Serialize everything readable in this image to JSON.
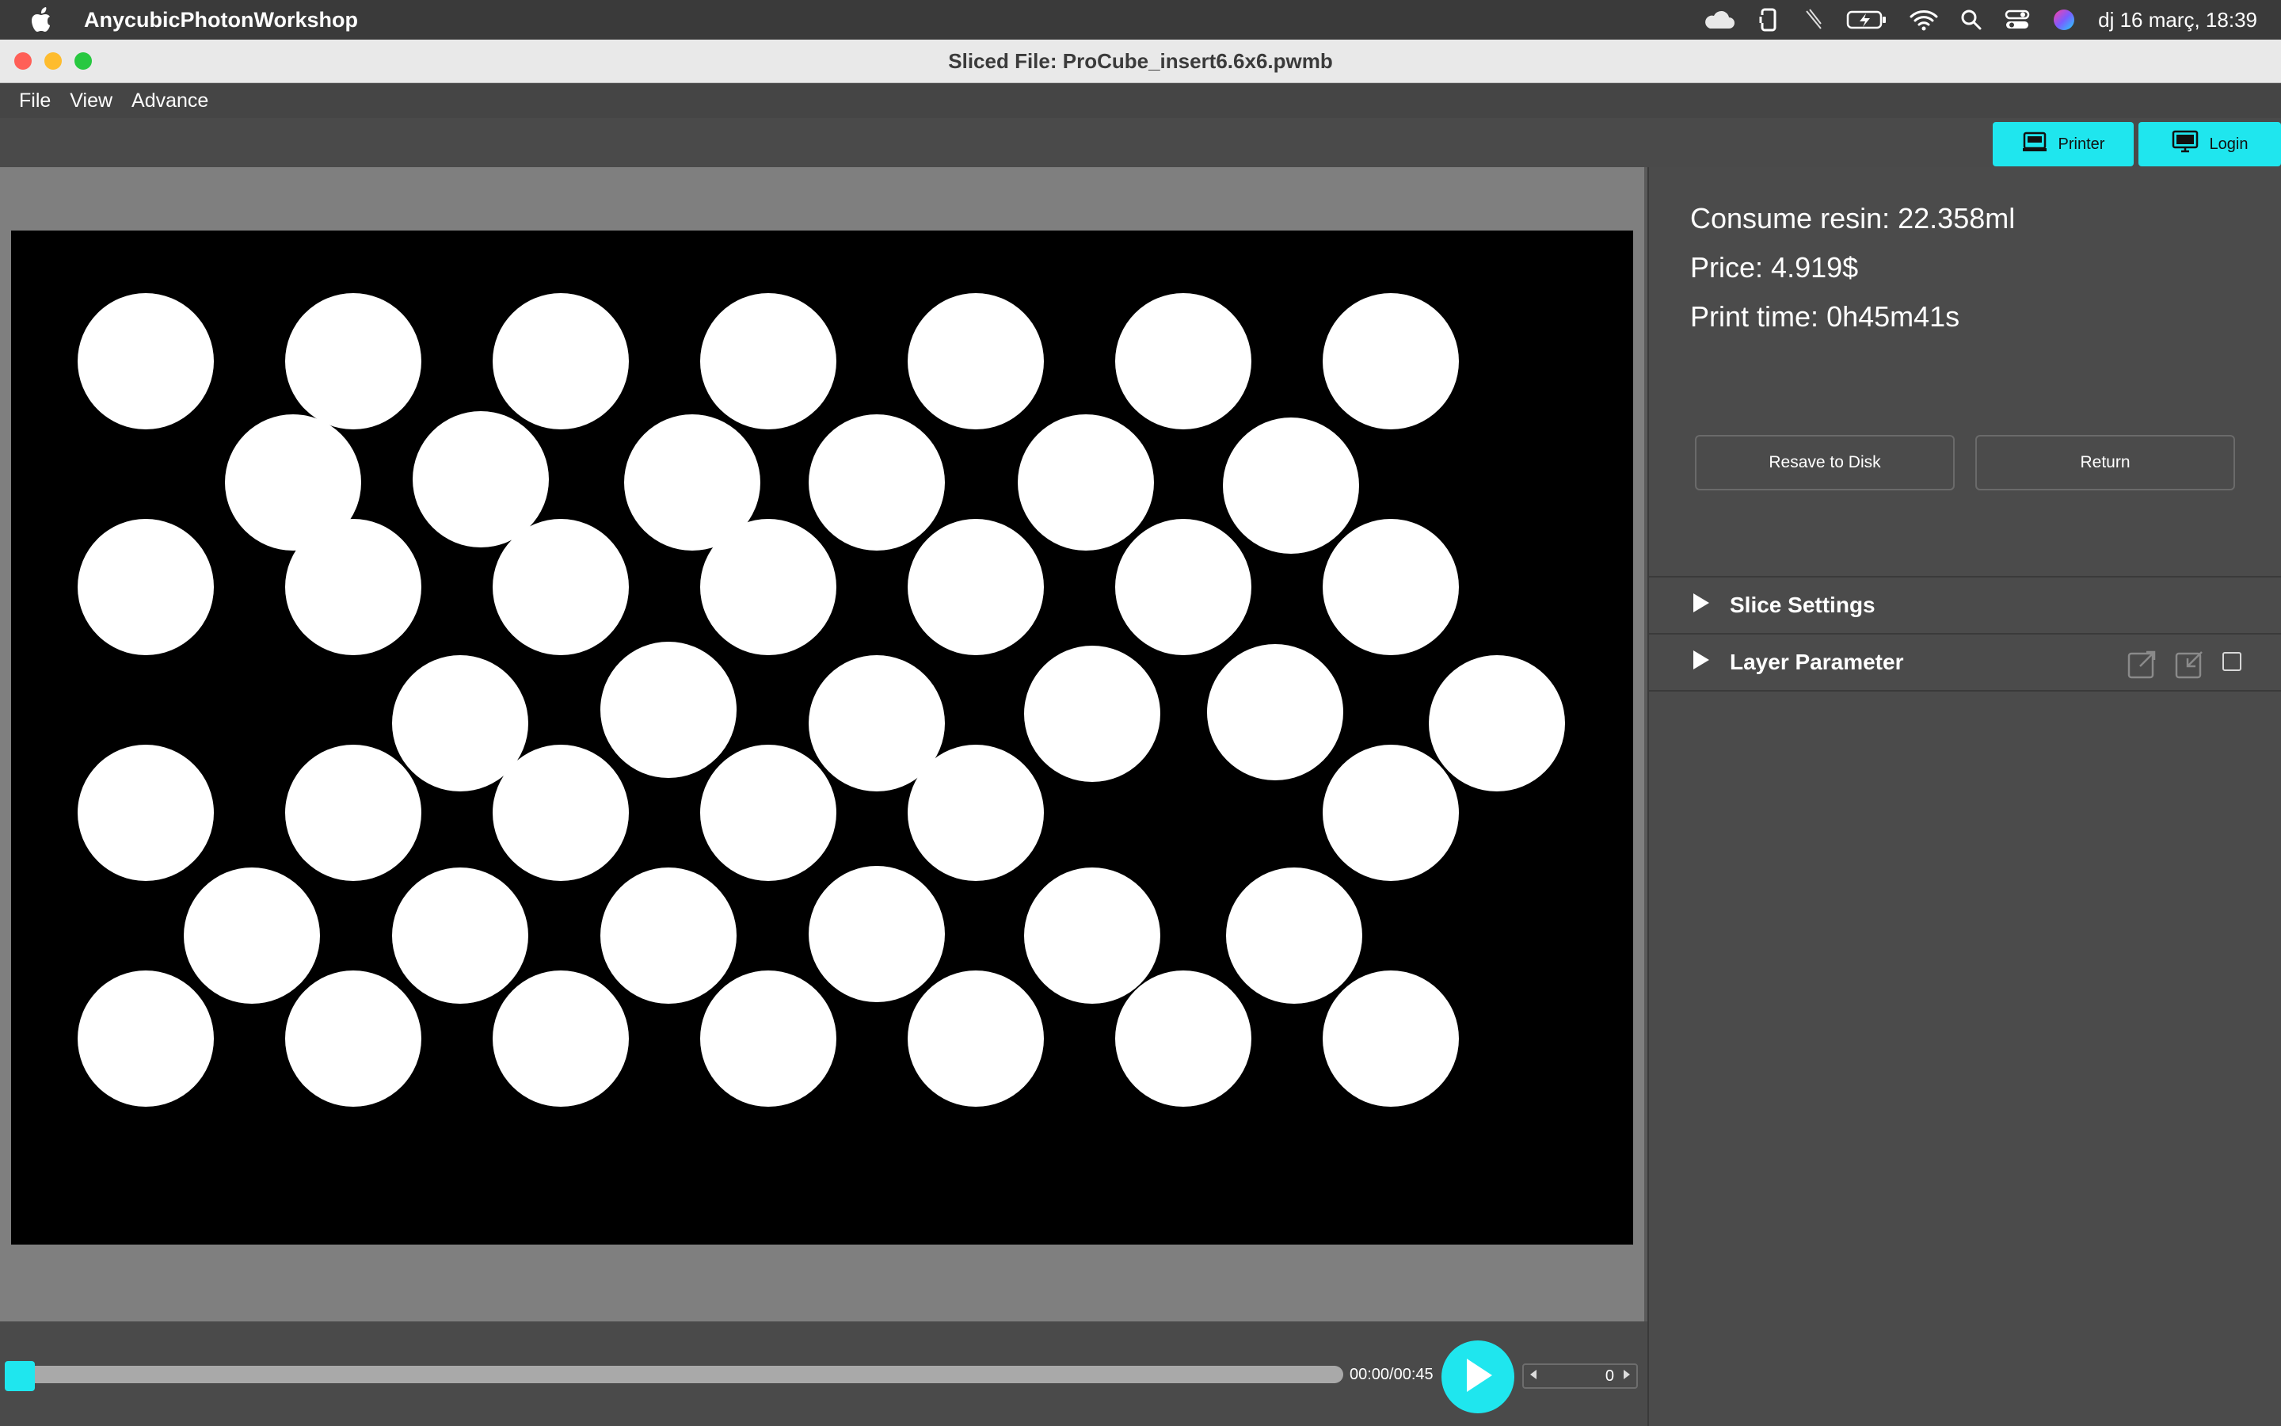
{
  "menubar": {
    "app_name": "AnycubicPhotonWorkshop",
    "clock": "dj 16 març, 18:39",
    "icons": [
      "apple-icon",
      "cloud-icon",
      "phone-sync-icon",
      "pen-icon",
      "battery-icon",
      "wifi-icon",
      "search-icon",
      "control-center-icon",
      "siri-icon"
    ]
  },
  "window": {
    "title": "Sliced File: ProCube_insert6.6x6.pwmb",
    "traffic_light_colors": [
      "#ff5f57",
      "#febc2e",
      "#28c840"
    ]
  },
  "app_menu": [
    "File",
    "View",
    "Advance"
  ],
  "toolbar": {
    "printer_label": "Printer",
    "login_label": "Login",
    "accent": "#1fe6ee"
  },
  "playback": {
    "timecode": "00:00/00:45",
    "layer_value": "0",
    "progress": 0
  },
  "info": {
    "resin_label": "Consume resin:",
    "resin_value": "22.358ml",
    "price_label": "Price:",
    "price_value": "4.919$",
    "time_label": "Print time:",
    "time_value": "0h45m41s"
  },
  "actions": {
    "resave_label": "Resave to Disk",
    "return_label": "Return"
  },
  "sections": {
    "slice_settings": "Slice Settings",
    "layer_parameter": "Layer Parameter"
  }
}
